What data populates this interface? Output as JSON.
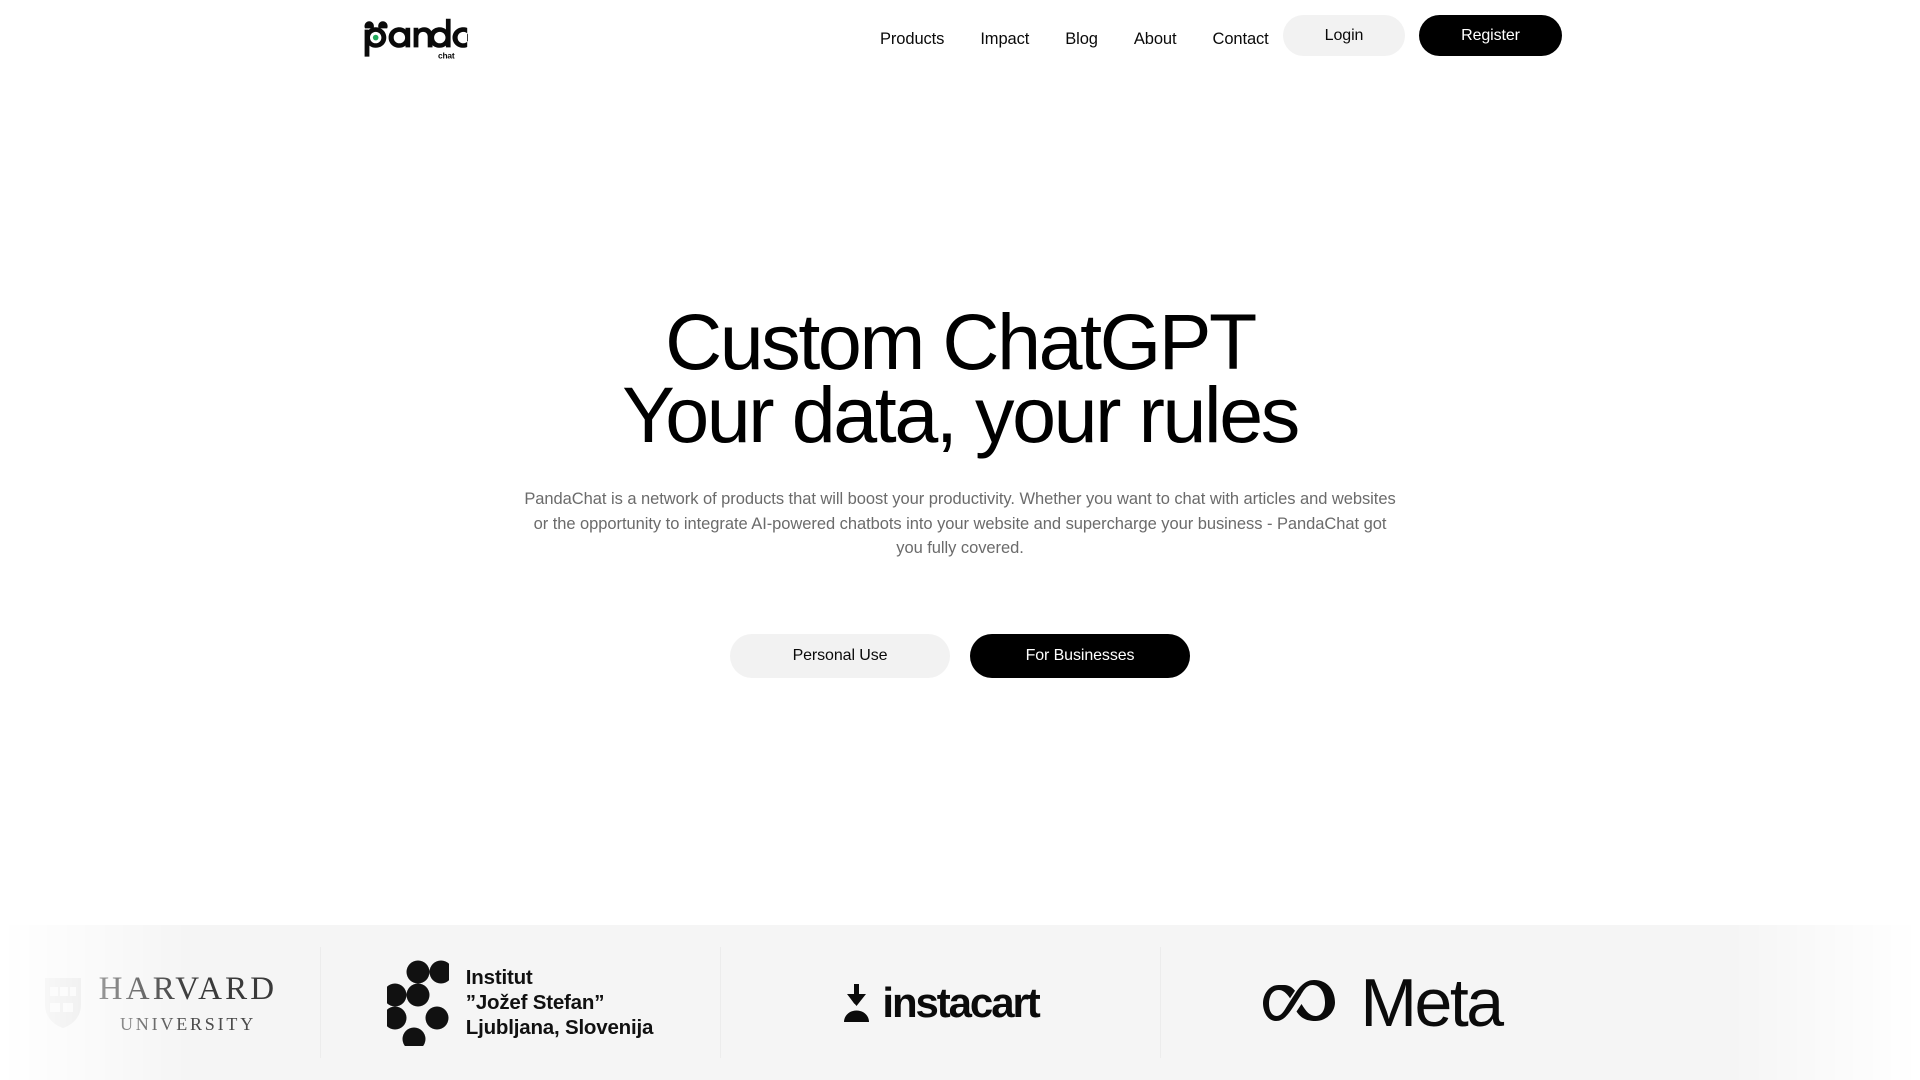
{
  "brand": {
    "name": "panda",
    "tagline": "chat",
    "accent_green": "#1fa85a",
    "logo_icon": "panda-face-logo"
  },
  "header": {
    "nav": [
      {
        "label": "Products"
      },
      {
        "label": "Impact"
      },
      {
        "label": "Blog"
      },
      {
        "label": "About"
      },
      {
        "label": "Contact"
      }
    ],
    "login_label": "Login",
    "register_label": "Register"
  },
  "hero": {
    "title_line1": "Custom ChatGPT",
    "title_line2": "Your data, your rules",
    "subtitle": "PandaChat is a network of products that will boost your productivity. Whether you want to chat with articles and websites or the opportunity to integrate AI-powered chatbots into your website and supercharge your business - PandaChat got you fully covered.",
    "cta_primary": "For Businesses",
    "cta_secondary": "Personal Use"
  },
  "logos": {
    "items": [
      {
        "id": "harvard",
        "name": "Harvard University",
        "line1": "HARVARD",
        "line2": "UNIVERSITY"
      },
      {
        "id": "jozef-stefan",
        "name": "Institut \"Jožef Stefan\" Ljubljana, Slovenija",
        "line1": "Institut",
        "line2": "”Jožef Stefan”",
        "line3": "Ljubljana, Slovenija"
      },
      {
        "id": "instacart",
        "name": "instacart",
        "wordmark": "instacart"
      },
      {
        "id": "meta",
        "name": "Meta",
        "wordmark": "Meta"
      }
    ]
  },
  "colors": {
    "page_bg": "#ffffff",
    "text": "#000000",
    "muted_text": "#6b6b6b",
    "pill_light": "#f2f2f2",
    "pill_dark": "#000000",
    "band_bg": "#f5f5f5"
  }
}
